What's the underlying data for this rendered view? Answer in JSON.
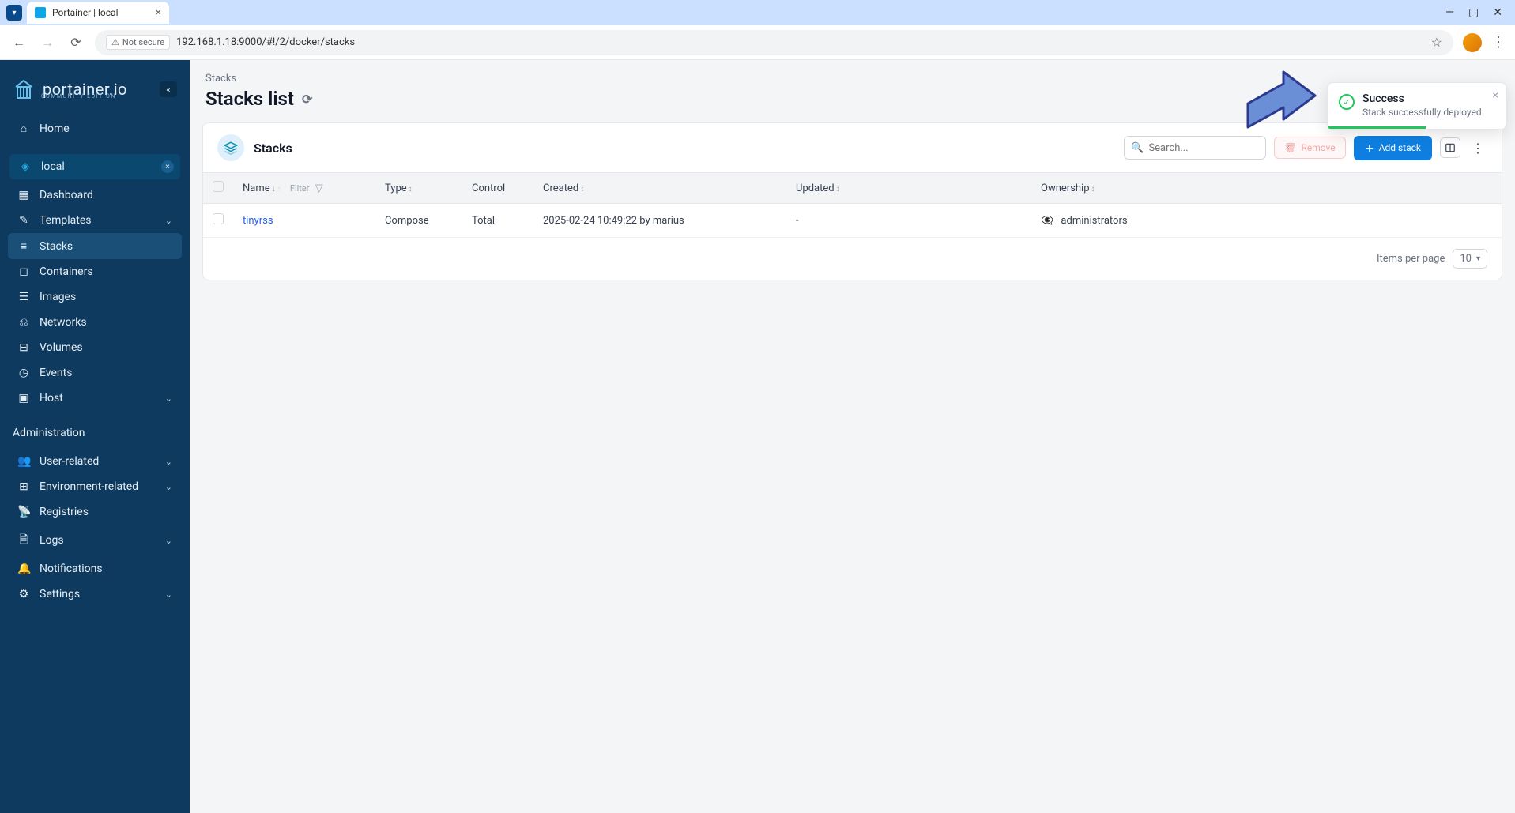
{
  "browser": {
    "tab_title": "Portainer | local",
    "security_label": "Not secure",
    "url": "192.168.1.18:9000/#!/2/docker/stacks"
  },
  "sidebar": {
    "brand": "portainer.io",
    "brand_sub": "COMMUNITY EDITION",
    "home": "Home",
    "env": "local",
    "items": {
      "dashboard": "Dashboard",
      "templates": "Templates",
      "stacks": "Stacks",
      "containers": "Containers",
      "images": "Images",
      "networks": "Networks",
      "volumes": "Volumes",
      "events": "Events",
      "host": "Host"
    },
    "admin_title": "Administration",
    "admin": {
      "user_related": "User-related",
      "env_related": "Environment-related",
      "registries": "Registries",
      "logs": "Logs",
      "notifications": "Notifications",
      "settings": "Settings"
    }
  },
  "page": {
    "breadcrumb": "Stacks",
    "title": "Stacks list",
    "panel_title": "Stacks",
    "search_placeholder": "Search...",
    "remove_label": "Remove",
    "add_label": "Add stack",
    "columns": {
      "name": "Name",
      "filter": "Filter",
      "type": "Type",
      "control": "Control",
      "created": "Created",
      "updated": "Updated",
      "ownership": "Ownership"
    },
    "rows": [
      {
        "name": "tinyrss",
        "type": "Compose",
        "control": "Total",
        "created": "2025-02-24 10:49:22 by marius",
        "updated": "-",
        "ownership": "administrators"
      }
    ],
    "items_per_page_label": "Items per page",
    "items_per_page_value": "10"
  },
  "toast": {
    "title": "Success",
    "message": "Stack successfully deployed"
  }
}
